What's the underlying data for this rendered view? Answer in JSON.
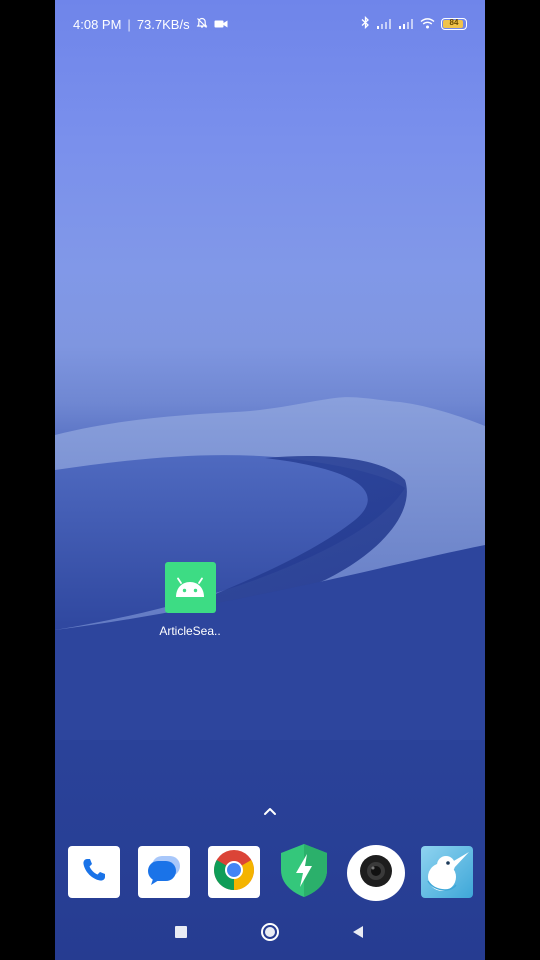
{
  "status_bar": {
    "time": "4:08 PM",
    "separator": "|",
    "network_speed": "73.7KB/s",
    "left_icons": [
      "alarm-off-icon",
      "video-record-icon"
    ],
    "right_icons": [
      "bluetooth-icon",
      "signal-1-icon",
      "signal-2-icon",
      "wifi-icon"
    ],
    "battery_level": "84"
  },
  "home": {
    "apps": [
      {
        "label": "ArticleSea..",
        "icon": "android-robot-icon",
        "color": "#3ddc84"
      }
    ],
    "drawer_icon": "chevron-up-icon"
  },
  "dock": {
    "apps": [
      {
        "name": "phone",
        "icon": "phone-icon"
      },
      {
        "name": "messages",
        "icon": "messages-icon"
      },
      {
        "name": "chrome",
        "icon": "chrome-icon"
      },
      {
        "name": "security",
        "icon": "shield-bolt-icon"
      },
      {
        "name": "camera",
        "icon": "camera-icon"
      },
      {
        "name": "browser",
        "icon": "kiwi-bird-icon"
      }
    ]
  },
  "nav_bar": {
    "buttons": [
      "recents-icon",
      "home-icon",
      "back-icon"
    ]
  },
  "colors": {
    "sky_top": "#6f85ea",
    "dune_dark": "#263c91",
    "android_green": "#3ddc84",
    "battery": "#f0c34a"
  }
}
